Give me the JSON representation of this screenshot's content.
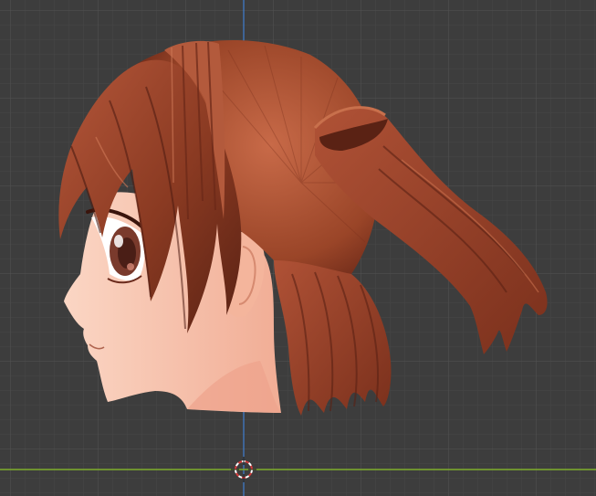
{
  "viewport": {
    "grid": true,
    "background_color": "#3d3d3d",
    "grid_minor_color": "#464646",
    "grid_major_color": "#525252",
    "z_axis_color": "#3f7fd0",
    "x_axis_color": "#7fae2d",
    "cursor_color": "#d63c3c",
    "icon": "3d-cursor-icon"
  },
  "model": {
    "hair_color": "#8a3a22",
    "hair_dark_color": "#4a1a10",
    "hair_light_color": "#c76a48",
    "skin_color": "#f6c2ac",
    "skin_shadow_color": "#eea38c",
    "eye_color": "#7a3a2c"
  }
}
